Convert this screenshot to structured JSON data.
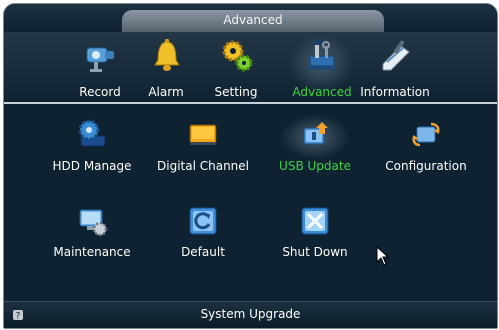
{
  "window": {
    "title": "Advanced"
  },
  "top_menu": [
    {
      "label": "Record",
      "icon": "camera-icon",
      "active": false
    },
    {
      "label": "Alarm",
      "icon": "bell-icon",
      "active": false
    },
    {
      "label": "Setting",
      "icon": "gears-icon",
      "active": false
    },
    {
      "label": "Advanced",
      "icon": "tools-icon",
      "active": true
    },
    {
      "label": "Information",
      "icon": "info-pen-icon",
      "active": false
    }
  ],
  "grid": [
    {
      "label": "HDD Manage",
      "icon": "hdd-icon",
      "active": false
    },
    {
      "label": "Digital Channel",
      "icon": "tv-icon",
      "active": false
    },
    {
      "label": "USB Update",
      "icon": "usb-update-icon",
      "active": true
    },
    {
      "label": "Configuration",
      "icon": "configuration-icon",
      "active": false
    },
    {
      "label": "Maintenance",
      "icon": "maintenance-icon",
      "active": false
    },
    {
      "label": "Default",
      "icon": "default-restore-icon",
      "active": false
    },
    {
      "label": "Shut Down",
      "icon": "shutdown-icon",
      "active": false
    }
  ],
  "status": {
    "text": "System Upgrade",
    "icon": "help-icon"
  },
  "colors": {
    "active_label": "#3cd63c",
    "background": "#0e2232",
    "title_tab": "#7a8793"
  }
}
